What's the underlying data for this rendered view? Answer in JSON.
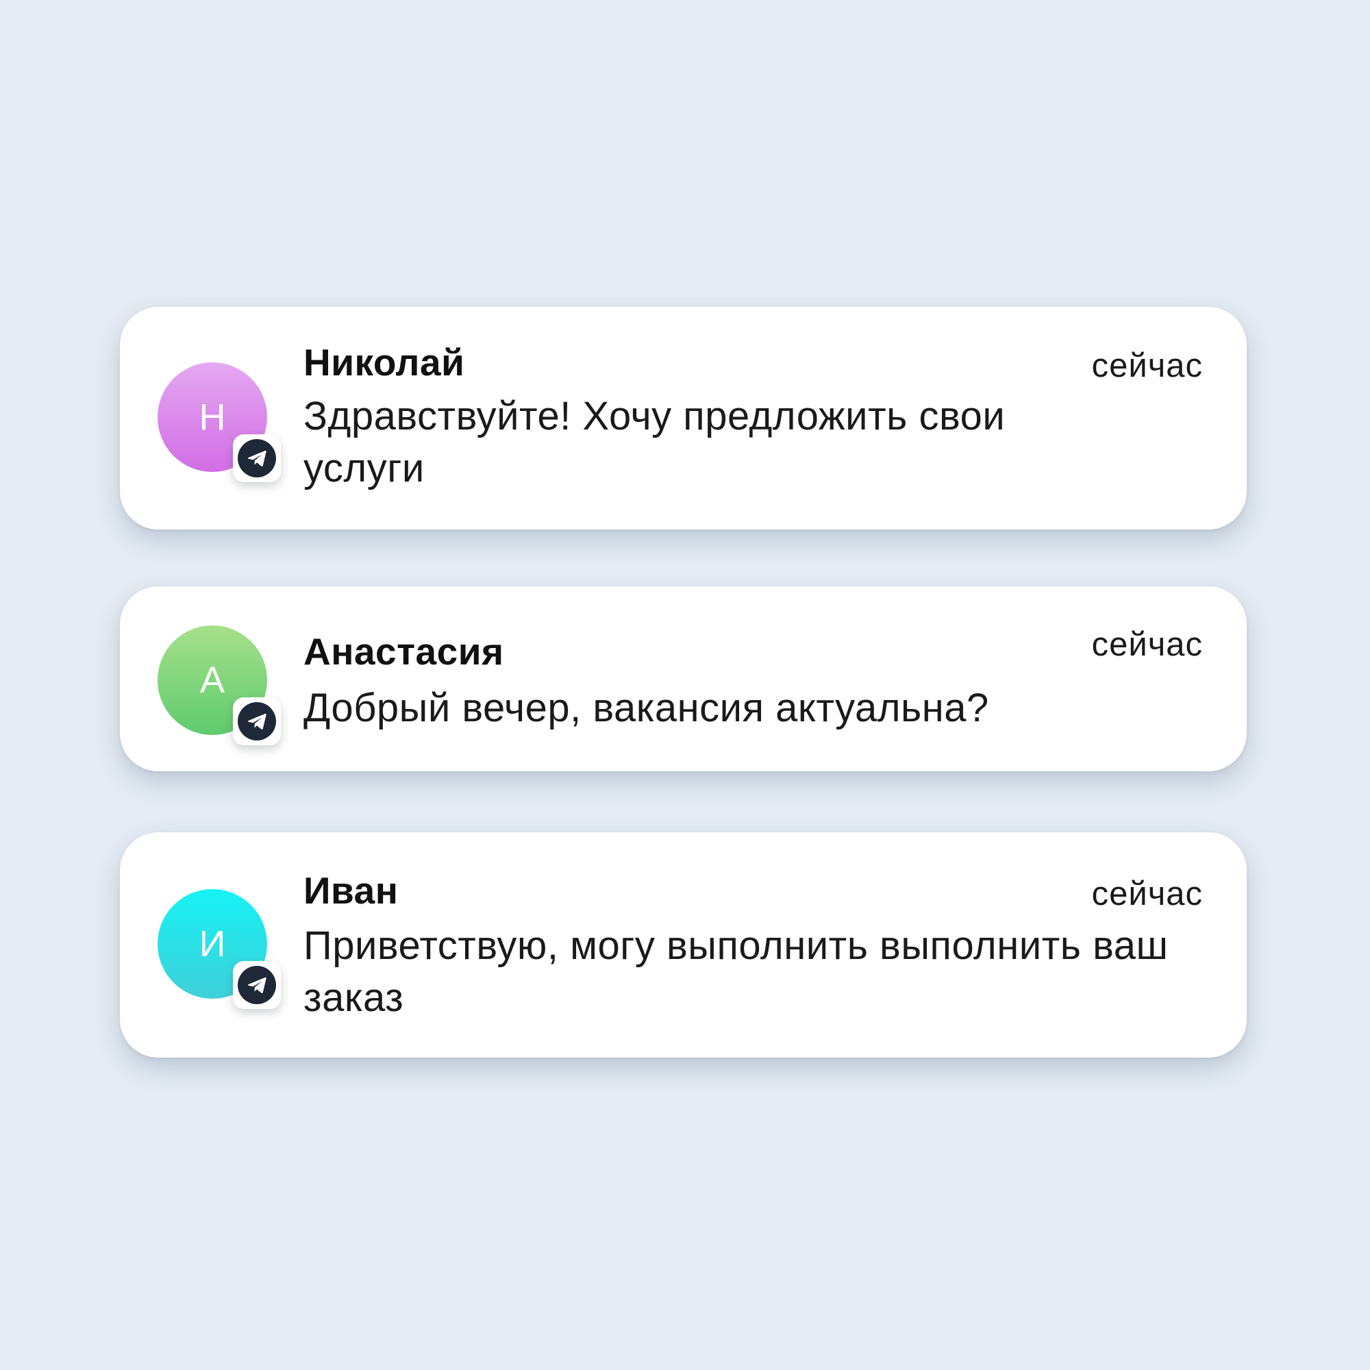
{
  "notifications": [
    {
      "name": "Николай",
      "time": "сейчас",
      "message": "Здравствуйте! Хочу предложить свои услуги",
      "avatar_letter": "Н",
      "avatar_color_top": "#e4a8f1",
      "avatar_color_bottom": "#d26ee6",
      "badge_icon": "telegram-icon"
    },
    {
      "name": "Анастасия",
      "time": "сейчас",
      "message": "Добрый вечер, вакансия актуальна?",
      "avatar_letter": "А",
      "avatar_color_top": "#a6e08a",
      "avatar_color_bottom": "#5fcb6e",
      "badge_icon": "telegram-icon"
    },
    {
      "name": "Иван",
      "time": "сейчас",
      "message": "Приветствую, могу выполнить выполнить ваш заказ",
      "avatar_letter": "И",
      "avatar_color_top": "#17f2f5",
      "avatar_color_bottom": "#3fd0d9",
      "badge_icon": "telegram-icon"
    }
  ]
}
